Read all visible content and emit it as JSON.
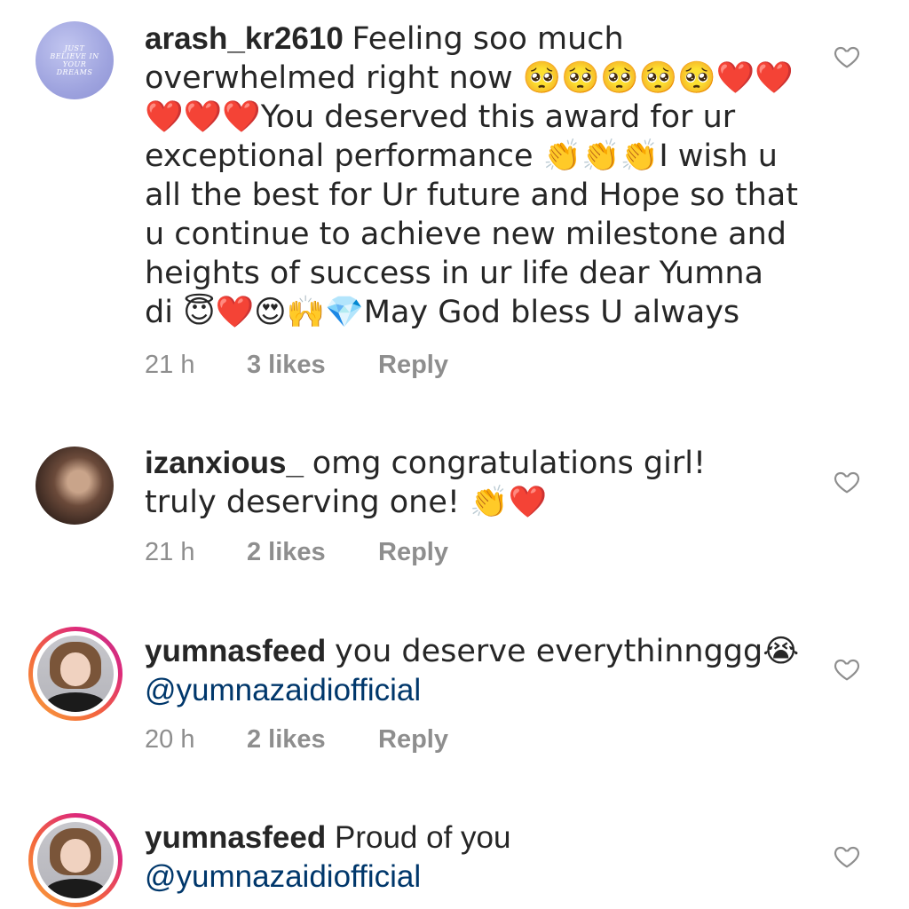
{
  "comments": [
    {
      "username": "arash_kr2610",
      "text": "Feeling soo much overwhelmed right now 🥺🥺🥺🥺🥺❤️❤️❤️❤️❤️You deserved this award for ur exceptional performance 👏👏👏I wish u all the best for Ur future and Hope so that u continue to achieve new milestone and heights of success in ur life dear Yumna di 😇❤️😍🙌💎May God bless U always",
      "time": "21 h",
      "likes": "3 likes",
      "reply": "Reply",
      "avatar_text": "JUST BELIEVE IN YOUR DREAMS",
      "avatar_style": "plain"
    },
    {
      "username": "izanxious_",
      "text": "omg congratulations girl! truly deserving one! 👏❤️",
      "time": "21 h",
      "likes": "2 likes",
      "reply": "Reply",
      "avatar_style": "plain"
    },
    {
      "username": "yumnasfeed",
      "text": "you deserve everythinnggg😭",
      "mention": "@yumnazaidiofficial",
      "time": "20 h",
      "likes": "2 likes",
      "reply": "Reply",
      "avatar_style": "story-ring"
    },
    {
      "username": "yumnasfeed",
      "text": "Proud of you",
      "mention": "@yumnazaidiofficial",
      "avatar_style": "story-ring"
    }
  ],
  "icons": {
    "like": "heart-outline-icon"
  },
  "colors": {
    "text": "#262626",
    "meta": "#8e8e8e",
    "mention": "#00376b",
    "like_icon": "#8e8e8e"
  }
}
